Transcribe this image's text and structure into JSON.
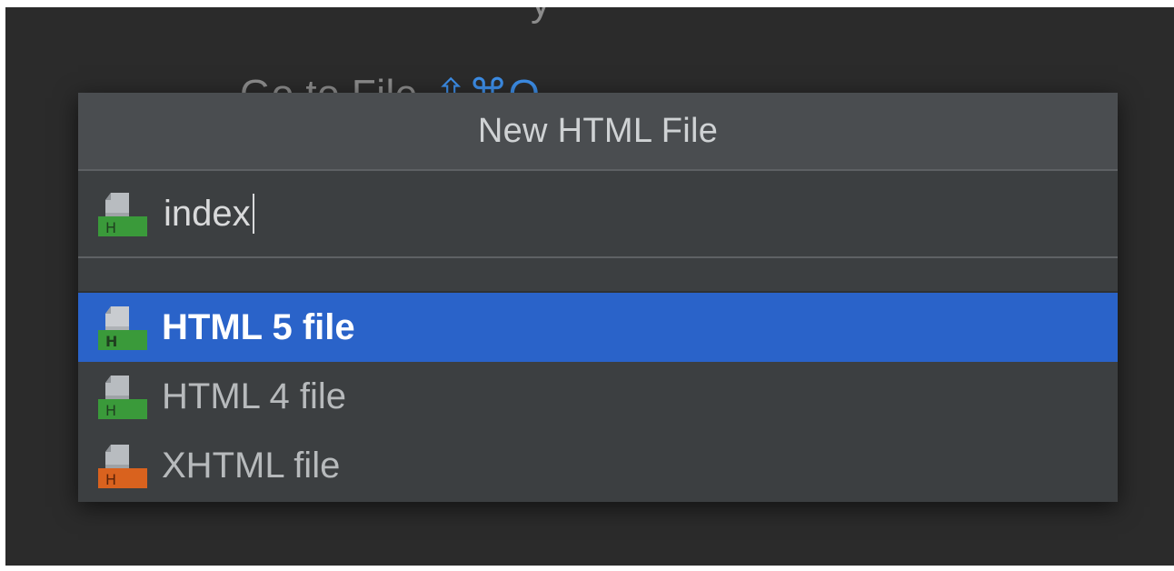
{
  "background": {
    "hint_text": "Go to File",
    "hint_shortcut": "⇧⌘O",
    "top_glyph": "y"
  },
  "dialog": {
    "title": "New HTML File",
    "name_input": {
      "value": "index",
      "icon": "html-file-icon"
    },
    "options": [
      {
        "label": "HTML 5 file",
        "icon": "html-file-icon",
        "selected": true,
        "badge_color": "#3a9a3a"
      },
      {
        "label": "HTML 4 file",
        "icon": "html-file-icon",
        "selected": false,
        "badge_color": "#3a9a3a"
      },
      {
        "label": "XHTML file",
        "icon": "xhtml-file-icon",
        "selected": false,
        "badge_color": "#d9621e"
      }
    ]
  },
  "colors": {
    "selection": "#2a63c9",
    "dialog_bg": "#3c3f41",
    "header_bg": "#4a4d50",
    "backdrop": "#2b2b2b",
    "shortcut_accent": "#3d8ee8"
  }
}
